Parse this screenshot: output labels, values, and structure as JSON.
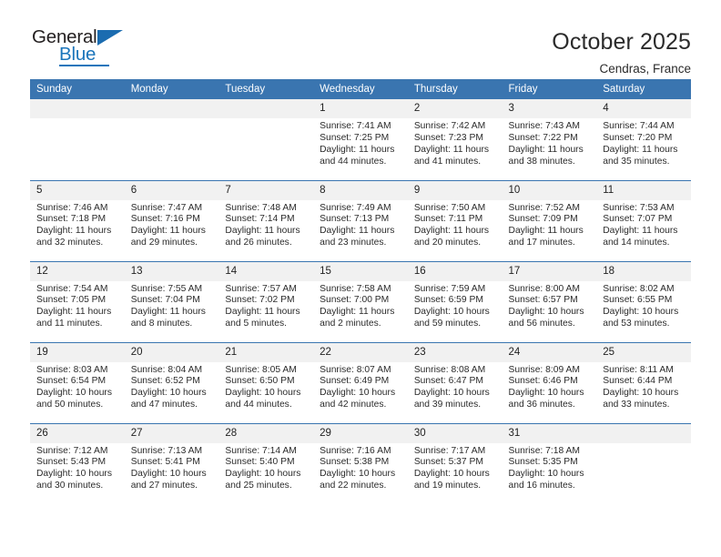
{
  "brand": {
    "name_part1": "General",
    "name_part2": "Blue",
    "triangle_color": "#1b6cb0",
    "blue_color": "#1b75bb"
  },
  "header": {
    "title": "October 2025",
    "subtitle": "Cendras, France"
  },
  "calendar": {
    "header_bg": "#3a75b0",
    "daynum_bg": "#f1f1f1",
    "weekdays": [
      "Sunday",
      "Monday",
      "Tuesday",
      "Wednesday",
      "Thursday",
      "Friday",
      "Saturday"
    ],
    "weeks": [
      [
        {
          "day": "",
          "empty": true
        },
        {
          "day": "",
          "empty": true
        },
        {
          "day": "",
          "empty": true
        },
        {
          "day": "1",
          "sunrise": "Sunrise: 7:41 AM",
          "sunset": "Sunset: 7:25 PM",
          "daylight1": "Daylight: 11 hours",
          "daylight2": "and 44 minutes."
        },
        {
          "day": "2",
          "sunrise": "Sunrise: 7:42 AM",
          "sunset": "Sunset: 7:23 PM",
          "daylight1": "Daylight: 11 hours",
          "daylight2": "and 41 minutes."
        },
        {
          "day": "3",
          "sunrise": "Sunrise: 7:43 AM",
          "sunset": "Sunset: 7:22 PM",
          "daylight1": "Daylight: 11 hours",
          "daylight2": "and 38 minutes."
        },
        {
          "day": "4",
          "sunrise": "Sunrise: 7:44 AM",
          "sunset": "Sunset: 7:20 PM",
          "daylight1": "Daylight: 11 hours",
          "daylight2": "and 35 minutes."
        }
      ],
      [
        {
          "day": "5",
          "sunrise": "Sunrise: 7:46 AM",
          "sunset": "Sunset: 7:18 PM",
          "daylight1": "Daylight: 11 hours",
          "daylight2": "and 32 minutes."
        },
        {
          "day": "6",
          "sunrise": "Sunrise: 7:47 AM",
          "sunset": "Sunset: 7:16 PM",
          "daylight1": "Daylight: 11 hours",
          "daylight2": "and 29 minutes."
        },
        {
          "day": "7",
          "sunrise": "Sunrise: 7:48 AM",
          "sunset": "Sunset: 7:14 PM",
          "daylight1": "Daylight: 11 hours",
          "daylight2": "and 26 minutes."
        },
        {
          "day": "8",
          "sunrise": "Sunrise: 7:49 AM",
          "sunset": "Sunset: 7:13 PM",
          "daylight1": "Daylight: 11 hours",
          "daylight2": "and 23 minutes."
        },
        {
          "day": "9",
          "sunrise": "Sunrise: 7:50 AM",
          "sunset": "Sunset: 7:11 PM",
          "daylight1": "Daylight: 11 hours",
          "daylight2": "and 20 minutes."
        },
        {
          "day": "10",
          "sunrise": "Sunrise: 7:52 AM",
          "sunset": "Sunset: 7:09 PM",
          "daylight1": "Daylight: 11 hours",
          "daylight2": "and 17 minutes."
        },
        {
          "day": "11",
          "sunrise": "Sunrise: 7:53 AM",
          "sunset": "Sunset: 7:07 PM",
          "daylight1": "Daylight: 11 hours",
          "daylight2": "and 14 minutes."
        }
      ],
      [
        {
          "day": "12",
          "sunrise": "Sunrise: 7:54 AM",
          "sunset": "Sunset: 7:05 PM",
          "daylight1": "Daylight: 11 hours",
          "daylight2": "and 11 minutes."
        },
        {
          "day": "13",
          "sunrise": "Sunrise: 7:55 AM",
          "sunset": "Sunset: 7:04 PM",
          "daylight1": "Daylight: 11 hours",
          "daylight2": "and 8 minutes."
        },
        {
          "day": "14",
          "sunrise": "Sunrise: 7:57 AM",
          "sunset": "Sunset: 7:02 PM",
          "daylight1": "Daylight: 11 hours",
          "daylight2": "and 5 minutes."
        },
        {
          "day": "15",
          "sunrise": "Sunrise: 7:58 AM",
          "sunset": "Sunset: 7:00 PM",
          "daylight1": "Daylight: 11 hours",
          "daylight2": "and 2 minutes."
        },
        {
          "day": "16",
          "sunrise": "Sunrise: 7:59 AM",
          "sunset": "Sunset: 6:59 PM",
          "daylight1": "Daylight: 10 hours",
          "daylight2": "and 59 minutes."
        },
        {
          "day": "17",
          "sunrise": "Sunrise: 8:00 AM",
          "sunset": "Sunset: 6:57 PM",
          "daylight1": "Daylight: 10 hours",
          "daylight2": "and 56 minutes."
        },
        {
          "day": "18",
          "sunrise": "Sunrise: 8:02 AM",
          "sunset": "Sunset: 6:55 PM",
          "daylight1": "Daylight: 10 hours",
          "daylight2": "and 53 minutes."
        }
      ],
      [
        {
          "day": "19",
          "sunrise": "Sunrise: 8:03 AM",
          "sunset": "Sunset: 6:54 PM",
          "daylight1": "Daylight: 10 hours",
          "daylight2": "and 50 minutes."
        },
        {
          "day": "20",
          "sunrise": "Sunrise: 8:04 AM",
          "sunset": "Sunset: 6:52 PM",
          "daylight1": "Daylight: 10 hours",
          "daylight2": "and 47 minutes."
        },
        {
          "day": "21",
          "sunrise": "Sunrise: 8:05 AM",
          "sunset": "Sunset: 6:50 PM",
          "daylight1": "Daylight: 10 hours",
          "daylight2": "and 44 minutes."
        },
        {
          "day": "22",
          "sunrise": "Sunrise: 8:07 AM",
          "sunset": "Sunset: 6:49 PM",
          "daylight1": "Daylight: 10 hours",
          "daylight2": "and 42 minutes."
        },
        {
          "day": "23",
          "sunrise": "Sunrise: 8:08 AM",
          "sunset": "Sunset: 6:47 PM",
          "daylight1": "Daylight: 10 hours",
          "daylight2": "and 39 minutes."
        },
        {
          "day": "24",
          "sunrise": "Sunrise: 8:09 AM",
          "sunset": "Sunset: 6:46 PM",
          "daylight1": "Daylight: 10 hours",
          "daylight2": "and 36 minutes."
        },
        {
          "day": "25",
          "sunrise": "Sunrise: 8:11 AM",
          "sunset": "Sunset: 6:44 PM",
          "daylight1": "Daylight: 10 hours",
          "daylight2": "and 33 minutes."
        }
      ],
      [
        {
          "day": "26",
          "sunrise": "Sunrise: 7:12 AM",
          "sunset": "Sunset: 5:43 PM",
          "daylight1": "Daylight: 10 hours",
          "daylight2": "and 30 minutes."
        },
        {
          "day": "27",
          "sunrise": "Sunrise: 7:13 AM",
          "sunset": "Sunset: 5:41 PM",
          "daylight1": "Daylight: 10 hours",
          "daylight2": "and 27 minutes."
        },
        {
          "day": "28",
          "sunrise": "Sunrise: 7:14 AM",
          "sunset": "Sunset: 5:40 PM",
          "daylight1": "Daylight: 10 hours",
          "daylight2": "and 25 minutes."
        },
        {
          "day": "29",
          "sunrise": "Sunrise: 7:16 AM",
          "sunset": "Sunset: 5:38 PM",
          "daylight1": "Daylight: 10 hours",
          "daylight2": "and 22 minutes."
        },
        {
          "day": "30",
          "sunrise": "Sunrise: 7:17 AM",
          "sunset": "Sunset: 5:37 PM",
          "daylight1": "Daylight: 10 hours",
          "daylight2": "and 19 minutes."
        },
        {
          "day": "31",
          "sunrise": "Sunrise: 7:18 AM",
          "sunset": "Sunset: 5:35 PM",
          "daylight1": "Daylight: 10 hours",
          "daylight2": "and 16 minutes."
        },
        {
          "day": "",
          "empty": true
        }
      ]
    ]
  }
}
